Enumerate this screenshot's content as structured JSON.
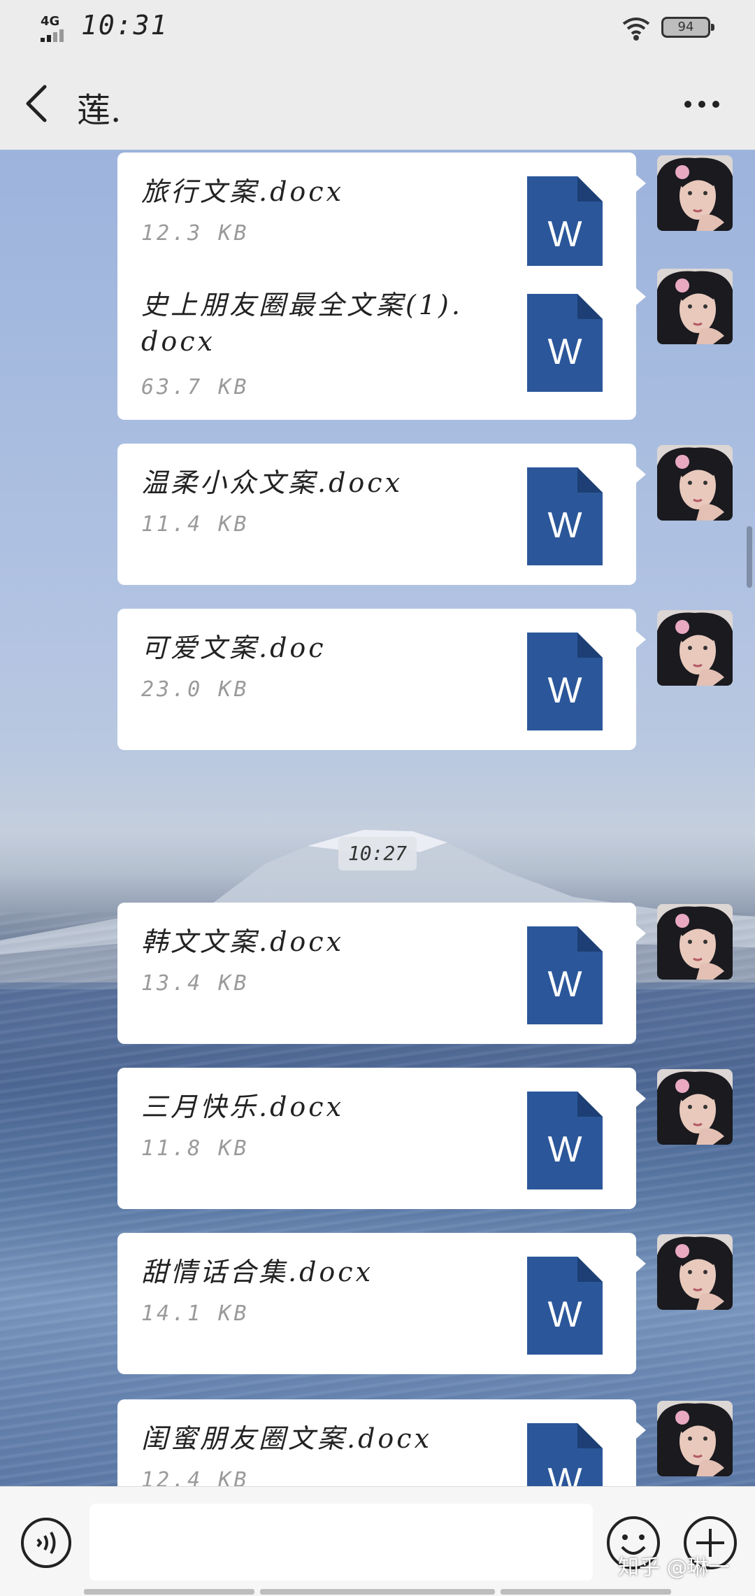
{
  "status_bar": {
    "network": "4G",
    "time": "10:31",
    "battery": "94"
  },
  "header": {
    "title": "莲."
  },
  "messages": [
    {
      "name": "旅行文案.docx",
      "size": "12.3 KB"
    },
    {
      "name": "史上朋友圈最全文案(1).docx",
      "size": "63.7 KB"
    },
    {
      "name": "温柔小众文案.docx",
      "size": "11.4 KB"
    },
    {
      "name": "可爱文案.doc",
      "size": "23.0 KB"
    },
    {
      "name": "韩文文案.docx",
      "size": "13.4 KB"
    },
    {
      "name": "三月快乐.docx",
      "size": "11.8 KB"
    },
    {
      "name": "甜情话合集.docx",
      "size": "14.1 KB"
    },
    {
      "name": "闺蜜朋友圈文案.docx",
      "size": "12.4 KB"
    }
  ],
  "timestamp": "10:27",
  "file_icon": {
    "letter": "W",
    "color": "#2b579a"
  },
  "watermark": "知乎 @琳一",
  "icons": [
    "back-icon",
    "more-icon",
    "word-file-icon",
    "voice-icon",
    "emoji-icon",
    "plus-icon"
  ]
}
